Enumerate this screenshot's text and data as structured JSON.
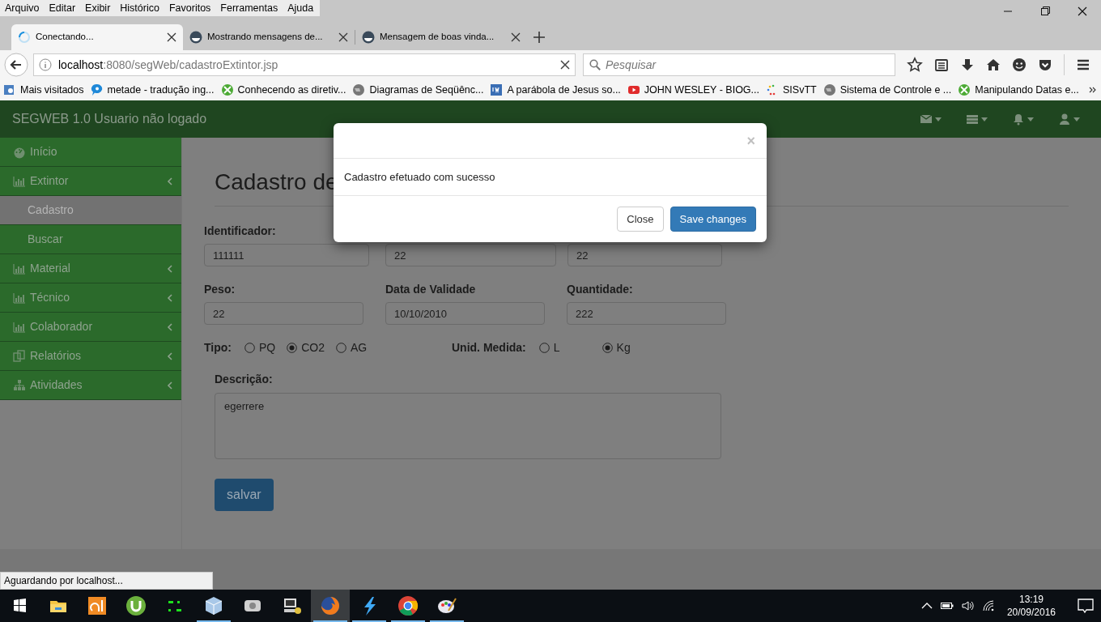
{
  "menu_bar": [
    "Arquivo",
    "Editar",
    "Exibir",
    "Histórico",
    "Favoritos",
    "Ferramentas",
    "Ajuda"
  ],
  "tabs": [
    {
      "label": "Conectando...",
      "selected": true,
      "loading": true
    },
    {
      "label": "Mostrando mensagens de...",
      "selected": false,
      "loading": false
    },
    {
      "label": "Mensagem de boas vinda...",
      "selected": false,
      "loading": false
    }
  ],
  "address_bar": {
    "host": "localhost",
    "path": ":8080/segWeb/cadastroExtintor.jsp"
  },
  "search": {
    "placeholder": "Pesquisar"
  },
  "bookmarks": [
    "Mais visitados",
    "metade - tradução ing...",
    "Conhecendo as diretiv...",
    "Diagramas de Seqüênc...",
    "A parábola de Jesus so...",
    "JOHN WESLEY - BIOG...",
    "SISvTT",
    "Sistema de Controle e ...",
    "Manipulando Datas e..."
  ],
  "navbar": {
    "brand": "SEGWEB 1.0 Usuario não logado"
  },
  "sidebar": {
    "items": [
      {
        "label": "Início",
        "selected": false
      },
      {
        "label": "Extintor",
        "selected": false,
        "children": [
          {
            "label": "Cadastro",
            "selected": true
          },
          {
            "label": "Buscar",
            "selected": false
          }
        ]
      },
      {
        "label": "Material",
        "selected": false
      },
      {
        "label": "Técnico",
        "selected": false
      },
      {
        "label": "Colaborador",
        "selected": false
      },
      {
        "label": "Relatórios",
        "selected": false
      },
      {
        "label": "Atividades",
        "selected": false
      }
    ]
  },
  "form": {
    "heading": "Cadastro de",
    "rows": [
      [
        {
          "label": "Identificador:",
          "value": "111111"
        },
        {
          "value": "22"
        },
        {
          "value": "22"
        }
      ],
      [
        {
          "label": "Peso:",
          "value": "22"
        },
        {
          "label": "Data de Validade",
          "value": "10/10/2010"
        },
        {
          "label": "Quantidade:",
          "value": "222"
        }
      ]
    ],
    "radio_groups": [
      {
        "label": "Tipo:",
        "options": [
          {
            "label": "PQ",
            "selected": false
          },
          {
            "label": "CO2",
            "selected": true
          },
          {
            "label": "AG",
            "selected": false
          }
        ]
      },
      {
        "label": "Unid. Medida:",
        "options": [
          {
            "label": "L",
            "selected": false
          },
          {
            "label": "Kg",
            "selected": true
          }
        ]
      }
    ],
    "description": {
      "label": "Descrição:",
      "value": "egerrere"
    },
    "submit": "salvar"
  },
  "modal": {
    "close": "×",
    "message": "Cadastro efetuado com sucesso",
    "buttons": [
      {
        "label": "Close",
        "kind": "default"
      },
      {
        "label": "Save changes",
        "kind": "primary"
      }
    ]
  },
  "status_text": "Aguardando por localhost...",
  "taskbar": {
    "apps": [
      {
        "running": false,
        "active": false
      },
      {
        "running": false,
        "active": false
      },
      {
        "running": false,
        "active": false
      },
      {
        "running": false,
        "active": false
      },
      {
        "running": true,
        "active": false
      },
      {
        "running": false,
        "active": false
      },
      {
        "running": false,
        "active": false
      },
      {
        "running": true,
        "active": true
      },
      {
        "running": true,
        "active": false
      },
      {
        "running": true,
        "active": false
      },
      {
        "running": true,
        "active": false
      }
    ],
    "time": "13:19",
    "date": "20/09/2016"
  }
}
